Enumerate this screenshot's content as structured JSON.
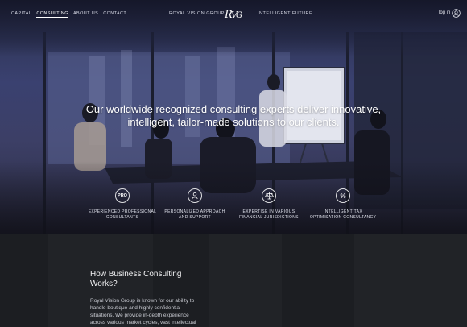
{
  "nav": {
    "links": [
      "CAPITAL",
      "CONSULTING",
      "ABOUT US",
      "CONTACT"
    ],
    "active_index": 1,
    "brand": "ROYAL VISION GROUP",
    "logo_text": "RVG",
    "tagline": "INTELLIGENT FUTURE",
    "login_label": "log in"
  },
  "hero": {
    "headline_line1": "Our worldwide recognized consulting experts deliver innovative,",
    "headline_line2": "intelligent, tailor-made solutions to our clients.",
    "features": [
      {
        "icon": "pro-icon",
        "glyph": "PRO",
        "line1": "EXPERIENCED PROFESSIONAL",
        "line2": "CONSULTANTS"
      },
      {
        "icon": "person-icon",
        "glyph": "",
        "line1": "PERSONALIZED APPROACH",
        "line2": "AND SUPPORT"
      },
      {
        "icon": "scales-icon",
        "glyph": "",
        "line1": "EXPERTISE IN VARIOUS",
        "line2": "FINANCIAL JURISDICTIONS"
      },
      {
        "icon": "percent-icon",
        "glyph": "%",
        "line1": "INTELLIGENT TAX",
        "line2": "OPTIMISATION CONSULTANCY"
      }
    ]
  },
  "section": {
    "title_line1": "How Business Consulting",
    "title_line2": "Works?",
    "body_lines": [
      "Royal Vision Group is known for our ability to",
      "handle boutique and highly confidential",
      "situations. We provide in-depth experience",
      "across various market cycles, vast intellectual"
    ]
  },
  "colors": {
    "hero_blue": "#3a4170",
    "dark_bg": "#1c1e22",
    "text_primary": "#ffffff"
  }
}
